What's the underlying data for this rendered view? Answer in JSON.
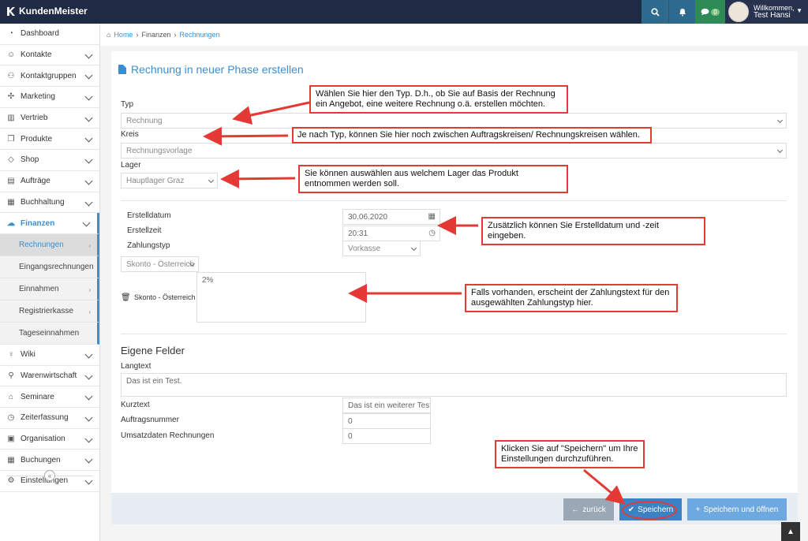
{
  "app": {
    "name": "KundenMeister"
  },
  "topbar": {
    "chat_count": "0",
    "welcome": "Willkommen,",
    "user_name": "Test Hansi"
  },
  "sidebar": {
    "items": [
      {
        "label": "Dashboard",
        "icon": "dashboard-icon"
      },
      {
        "label": "Kontakte",
        "icon": "contacts-icon"
      },
      {
        "label": "Kontaktgruppen",
        "icon": "group-icon"
      },
      {
        "label": "Marketing",
        "icon": "marketing-icon"
      },
      {
        "label": "Vertrieb",
        "icon": "chart-icon"
      },
      {
        "label": "Produkte",
        "icon": "box-icon"
      },
      {
        "label": "Shop",
        "icon": "tag-icon"
      },
      {
        "label": "Aufträge",
        "icon": "orders-icon"
      },
      {
        "label": "Buchhaltung",
        "icon": "ledger-icon"
      },
      {
        "label": "Finanzen",
        "icon": "finance-icon"
      }
    ],
    "finanzen_sub": [
      {
        "label": "Rechnungen"
      },
      {
        "label": "Eingangsrechnungen"
      },
      {
        "label": "Einnahmen"
      },
      {
        "label": "Registrierkasse"
      },
      {
        "label": "Tageseinnahmen"
      }
    ],
    "items_after": [
      {
        "label": "Wiki",
        "icon": "bulb-icon"
      },
      {
        "label": "Warenwirtschaft",
        "icon": "warehouse-icon"
      },
      {
        "label": "Seminare",
        "icon": "graduation-icon"
      },
      {
        "label": "Zeiterfassung",
        "icon": "clock-icon"
      },
      {
        "label": "Organisation",
        "icon": "clipboard-icon"
      },
      {
        "label": "Buchungen",
        "icon": "calendar-icon"
      },
      {
        "label": "Einstellungen",
        "icon": "gear-icon"
      }
    ]
  },
  "breadcrumb": {
    "home": "Home",
    "finanzen": "Finanzen",
    "current": "Rechnungen"
  },
  "page": {
    "title": "Rechnung in neuer Phase erstellen"
  },
  "form": {
    "typ_label": "Typ",
    "typ_value": "Rechnung",
    "kreis_label": "Kreis",
    "kreis_value": "Rechnungsvorlage",
    "lager_label": "Lager",
    "lager_value": "Hauptlager Graz",
    "erstelldatum_label": "Erstelldatum",
    "erstelldatum_value": "30.06.2020",
    "erstellzeit_label": "Erstellzeit",
    "erstellzeit_value": "20:31",
    "zahlungstyp_label": "Zahlungstyp",
    "zahlungstyp_value": "Vorkasse",
    "skonto_select": "Skonto - Österreich",
    "skonto_label": "Skonto - Österreich",
    "skonto_text": "2%",
    "eigene_felder": "Eigene Felder",
    "langtext_label": "Langtext",
    "langtext_value": "Das ist ein Test.",
    "kurztext_label": "Kurztext",
    "kurztext_value": "Das ist ein weiterer Test",
    "auftragsnummer_label": "Auftragsnummer",
    "auftragsnummer_value": "0",
    "umsatzdaten_label": "Umsatzdaten Rechnungen",
    "umsatzdaten_value": "0"
  },
  "buttons": {
    "back": "zurück",
    "save": "Speichern",
    "save_open": "Speichern und öffnen"
  },
  "notes": {
    "typ": "Wählen Sie hier den Typ. D.h., ob Sie auf Basis der Rechnung ein Angebot, eine weitere Rechnung o.ä. erstellen möchten.",
    "kreis": "Je nach Typ, können Sie hier noch zwischen Auftragskreisen/ Rechnungskreisen wählen.",
    "lager": "Sie können auswählen aus welchem Lager das Produkt entnommen werden soll.",
    "datum": "Zusätzlich können Sie Erstelldatum und -zeit eingeben.",
    "zahlungstext": "Falls vorhanden, erscheint der Zahlungstext für den ausgewählten Zahlungstyp hier.",
    "speichern": "Klicken Sie auf \"Speichern\" um Ihre Einstellungen durchzuführen."
  },
  "colors": {
    "accent": "#3b8fd0",
    "topbar": "#1f2a44",
    "annotation": "#e53935"
  }
}
